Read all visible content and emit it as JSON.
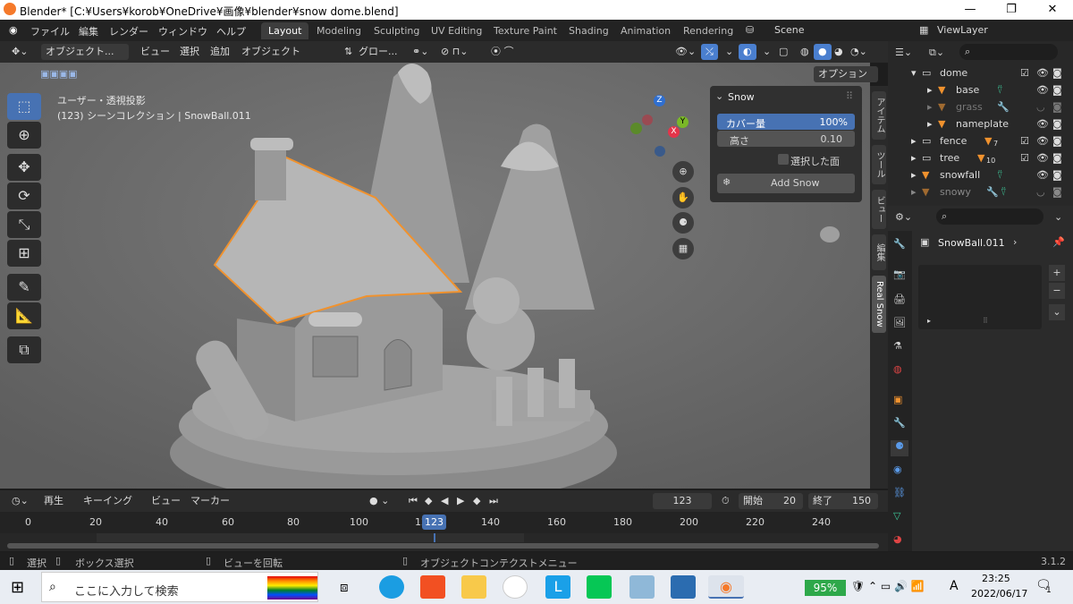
{
  "window": {
    "title": "Blender* [C:¥Users¥korob¥OneDrive¥画像¥blender¥snow dome.blend]"
  },
  "menu": {
    "items": [
      "ファイル",
      "編集",
      "レンダー",
      "ウィンドウ",
      "ヘルプ"
    ]
  },
  "workspaces": [
    "Layout",
    "Modeling",
    "Sculpting",
    "UV Editing",
    "Texture Paint",
    "Shading",
    "Animation",
    "Rendering"
  ],
  "scene": "Scene",
  "view_layer": "ViewLayer",
  "viewport_header": {
    "mode": "オブジェクト...",
    "menus": [
      "ビュー",
      "選択",
      "追加",
      "オブジェクト"
    ],
    "transform": "グロー...",
    "options": "オプション"
  },
  "viewport": {
    "view_label": "ユーザー・透視投影",
    "collection_label": "(123) シーンコレクション | SnowBall.011"
  },
  "snow_panel": {
    "title": "Snow",
    "coverage_label": "カバー量",
    "coverage_value": "100%",
    "height_label": "高さ",
    "height_value": "0.10",
    "selected_faces_label": "選択した面",
    "add_button": "Add Snow"
  },
  "vertical_tabs": [
    "アイテム",
    "ツール",
    "ビュー",
    "編集",
    "Real Snow"
  ],
  "outliner": {
    "items": [
      {
        "name": "dome",
        "level": 0
      },
      {
        "name": "base",
        "level": 1
      },
      {
        "name": "grass",
        "level": 1
      },
      {
        "name": "nameplate",
        "level": 1
      },
      {
        "name": "fence",
        "level": 0,
        "badge": "7"
      },
      {
        "name": "tree",
        "level": 0,
        "badge": "10"
      },
      {
        "name": "snowfall",
        "level": 0
      },
      {
        "name": "snowy",
        "level": 0
      }
    ]
  },
  "properties": {
    "object_name": "SnowBall.011"
  },
  "timeline": {
    "menus": [
      "再生",
      "キーイング",
      "ビュー",
      "マーカー"
    ],
    "current_frame": "123",
    "start_label": "開始",
    "start_value": "20",
    "end_label": "終了",
    "end_value": "150",
    "ticks": [
      "0",
      "20",
      "40",
      "60",
      "80",
      "100",
      "120",
      "140",
      "160",
      "180",
      "200",
      "220",
      "240"
    ]
  },
  "status_bar": {
    "select": "選択",
    "box_select": "ボックス選択",
    "rotate_view": "ビューを回転",
    "context_menu": "オブジェクトコンテクストメニュー",
    "version": "3.1.2"
  },
  "taskbar": {
    "search_placeholder": "ここに入力して検索",
    "battery": "95%",
    "ime": "A",
    "time": "23:25",
    "date": "2022/06/17",
    "notifications": "1"
  },
  "colors": {
    "accent": "#4772b3",
    "selection_outline": "#f0922e",
    "viewport_bg": "#6a6a6a"
  }
}
